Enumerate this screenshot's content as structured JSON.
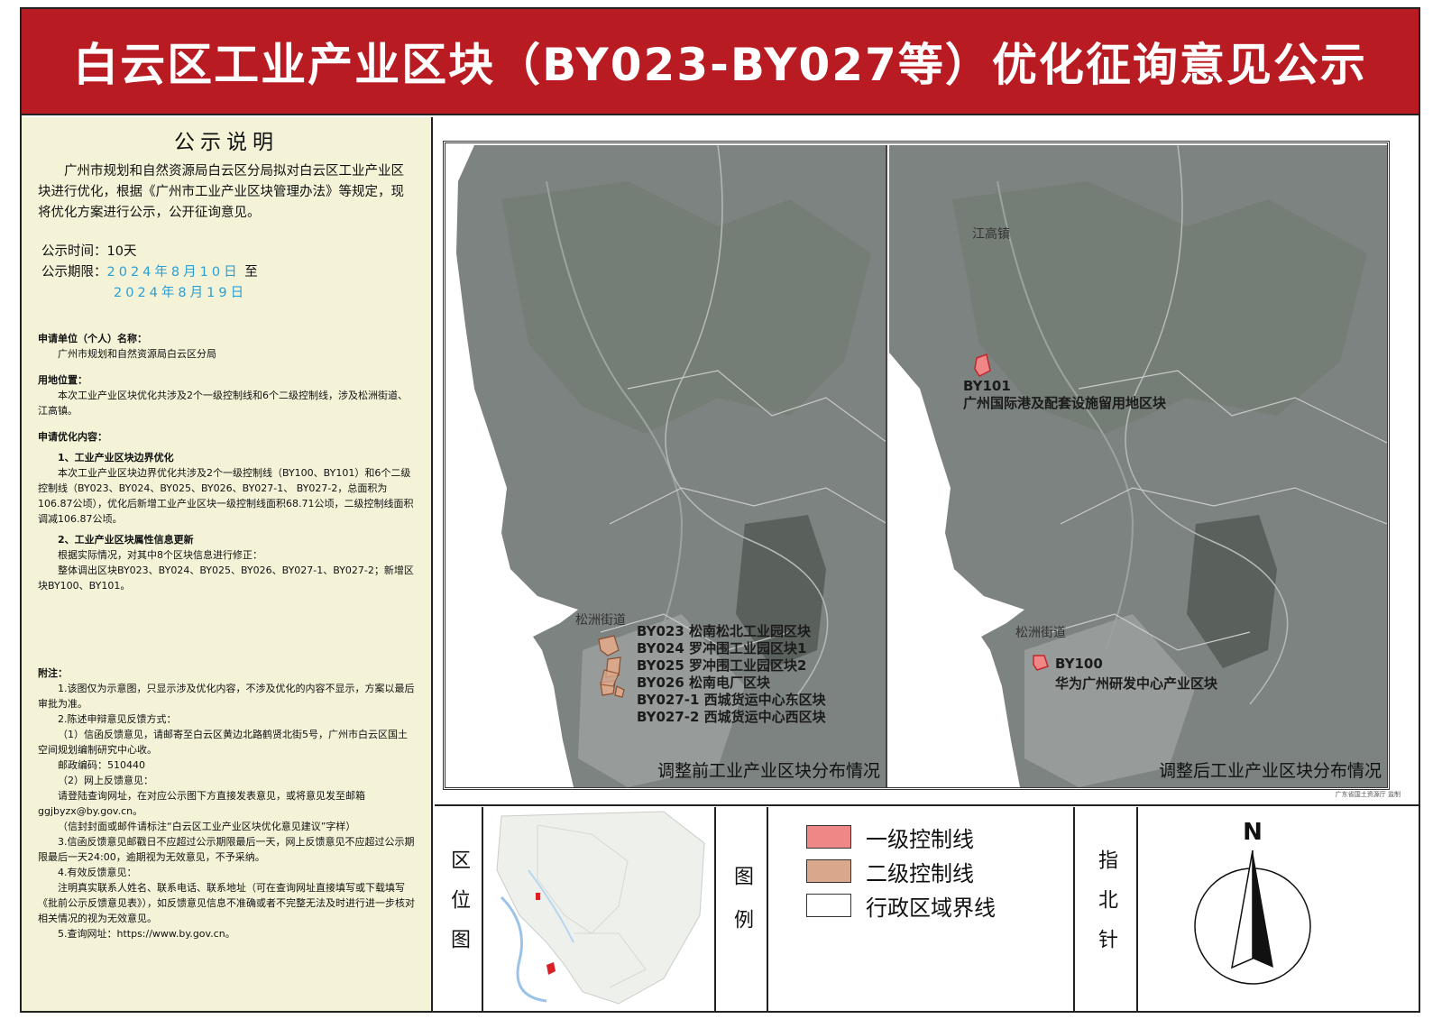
{
  "header": {
    "title": "白云区工业产业区块（BY023-BY027等）优化征询意见公示"
  },
  "notice": {
    "title": "公示说明",
    "intro": "广州市规划和自然资源局白云区分局拟对白云区工业产业区块进行优化，根据《广州市工业产业区块管理办法》等规定，现将优化方案进行公示，公开征询意见。",
    "period_label": "公示时间：",
    "period_value": "10天",
    "range_label": "公示期限：",
    "start_date": "2024年8月10日",
    "to": "至",
    "end_date": "2024年8月19日",
    "applicant_heading": "申请单位（个人）名称：",
    "applicant": "广州市规划和自然资源局白云区分局",
    "location_heading": "用地位置：",
    "location": "本次工业产业区块优化共涉及2个一级控制线和6个二级控制线，涉及松洲街道、江高镇。",
    "content_heading": "申请优化内容：",
    "item1_heading": "1、工业产业区块边界优化",
    "item1_text": "本次工业产业区块边界优化共涉及2个一级控制线（BY100、BY101）和6个二级控制线（BY023、BY024、BY025、BY026、BY027-1、 BY027-2，总面积为106.87公顷），优化后新增工业产业区块一级控制线面积68.71公顷，二级控制线面积调减106.87公顷。",
    "item2_heading": "2、工业产业区块属性信息更新",
    "item2_text1": "根据实际情况，对其中8个区块信息进行修正：",
    "item2_text2": "整体调出区块BY023、BY024、BY025、BY026、BY027-1、BY027-2；新增区块BY100、BY101。",
    "notes_heading": "附注：",
    "note1": "1.该图仅为示意图，只显示涉及优化内容，不涉及优化的内容不显示，方案以最后审批为准。",
    "note2": "2.陈述申辩意见反馈方式：",
    "note2_1": "（1）信函反馈意见，请邮寄至白云区黄边北路鹤贤北街5号，广州市白云区国土空间规划编制研究中心收。",
    "postcode": "邮政编码：510440",
    "note2_2": "（2）网上反馈意见：",
    "note2_2_text": "请登陆查询网址，在对应公示图下方直接发表意见，或将意见发至邮箱ggjbyzx@by.gov.cn。",
    "note2_3": "（信封封面或邮件请标注“白云区工业产业区块优化意见建议”字样）",
    "note3": "3.信函反馈意见邮戳日不应超过公示期限最后一天，网上反馈意见不应超过公示期限最后一天24:00，逾期视为无效意见，不予采纳。",
    "note4": "4.有效反馈意见：",
    "note4_text": "注明真实联系人姓名、联系电话、联系地址（可在查询网址直接填写或下载填写《批前公示反馈意见表》），如反馈意见信息不准确或者不完整无法及时进行进一步核对相关情况的视为无效意见。",
    "note5": "5.查询网址：https://www.by.gov.cn。"
  },
  "map_before": {
    "caption": "调整前工业产业区块分布情况",
    "place": "松洲街道",
    "labels": [
      "BY023 松南松北工业园区块",
      "BY024 罗冲围工业园区块1",
      "BY025 罗冲围工业园区块2",
      "BY026 松南电厂区块",
      "BY027-1 西城货运中心东区块",
      "BY027-2 西城货运中心西区块"
    ]
  },
  "map_after": {
    "caption": "调整后工业产业区块分布情况",
    "place_north": "江高镇",
    "place_south": "松洲街道",
    "by101_code": "BY101",
    "by101_name": "广州国际港及配套设施留用地区块",
    "by100_code": "BY100",
    "by100_name": "华为广州研发中心产业区块"
  },
  "credit": "广东省国土资源厅 监制",
  "location_map": {
    "label": "区位图"
  },
  "legend": {
    "label": "图例",
    "items": [
      {
        "name": "一级控制线",
        "color": "#f08787"
      },
      {
        "name": "二级控制线",
        "color": "#d9a88c"
      },
      {
        "name": "行政区域界线",
        "color": "#ffffff"
      }
    ]
  },
  "north_arrow": {
    "label": "指北针",
    "letter": "N"
  }
}
